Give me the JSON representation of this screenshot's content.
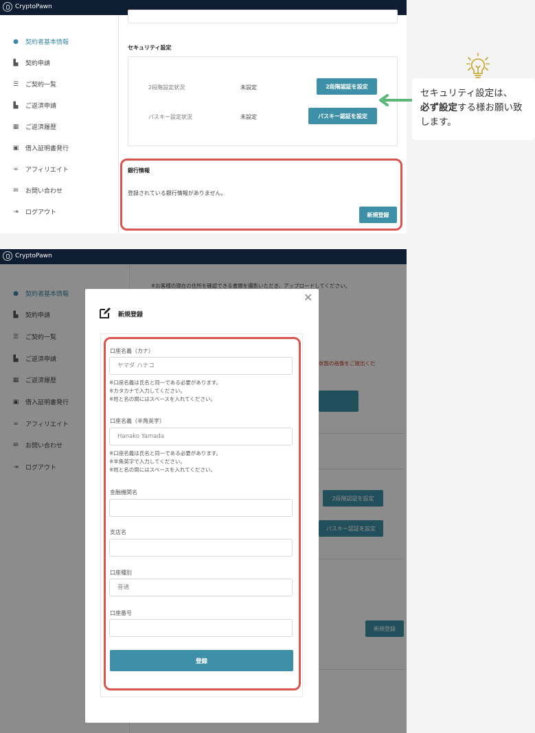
{
  "app": {
    "name": "CryptoPawn"
  },
  "sidebar": {
    "items": [
      {
        "label": "契約者基本情報",
        "icon": "person-icon",
        "active": true
      },
      {
        "label": "契約申請",
        "icon": "edit-document-icon"
      },
      {
        "label": "ご契約一覧",
        "icon": "list-icon"
      },
      {
        "label": "ご返済申請",
        "icon": "edit-document-icon"
      },
      {
        "label": "ご返済履歴",
        "icon": "calendar-icon"
      },
      {
        "label": "借入証明書発行",
        "icon": "id-card-icon"
      },
      {
        "label": "アフィリエイト",
        "icon": "handshake-icon"
      },
      {
        "label": "お問い合わせ",
        "icon": "mail-icon"
      },
      {
        "label": "ログアウト",
        "icon": "logout-icon"
      }
    ]
  },
  "security": {
    "title": "セキュリティ設定",
    "rows": [
      {
        "label": "2段階設定状況",
        "status": "未設定",
        "button": "2段階認証を設定"
      },
      {
        "label": "パスキー設定状況",
        "status": "未設定",
        "button": "パスキー認証を設定"
      }
    ]
  },
  "bank": {
    "title": "銀行情報",
    "empty_message": "登録されている銀行情報がありません。",
    "register_button": "新規登録"
  },
  "tip": {
    "part1": "セキュリティ設定は、",
    "bold": "必ず設定",
    "part2": "する様お願い致します。"
  },
  "background": {
    "upload_note": "※お客様の現在の住所を確認できる書類を撮影いただき、アップロードしてください。",
    "red_note": "状態の画像をご提出くだ",
    "two_factor_button": "2段階認証を設定",
    "passkey_button": "パスキー認証を設定",
    "register_button": "新規登録"
  },
  "modal": {
    "title": "新規登録",
    "fields": {
      "kana": {
        "label": "口座名義（カナ）",
        "placeholder": "ヤマダ ハナコ"
      },
      "roman": {
        "label": "口座名義（半角英字）",
        "placeholder": "Hanako Yamada"
      },
      "bank_name": {
        "label": "金融機関名",
        "placeholder": ""
      },
      "branch": {
        "label": "支店名",
        "placeholder": ""
      },
      "account_type": {
        "label": "口座種別",
        "placeholder": "普通"
      },
      "account_number": {
        "label": "口座番号",
        "placeholder": ""
      }
    },
    "kana_notes": [
      "※口座名義は氏名と同一である必要があります。",
      "※カタカナで入力してください。",
      "※姓と名の間にはスペースを入れてください。"
    ],
    "roman_notes": [
      "※口座名義は氏名と同一である必要があります。",
      "※半角英字で入力してください。",
      "※姓と名の間にはスペースを入れてください。"
    ],
    "submit": "登録"
  },
  "colors": {
    "accent": "#3d90a7",
    "highlight": "#d9534f",
    "arrow": "#5cb87a",
    "header": "#0f1d33"
  }
}
